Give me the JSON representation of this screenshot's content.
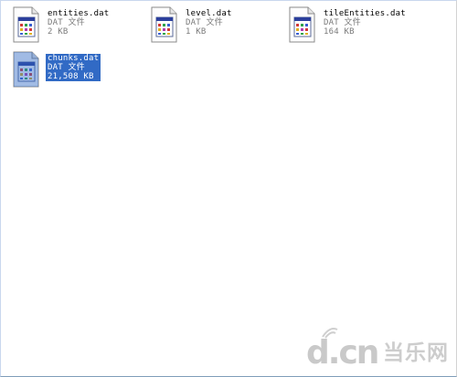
{
  "files": [
    {
      "name": "entities.dat",
      "type": "DAT 文件",
      "size": "2 KB",
      "selected": false
    },
    {
      "name": "level.dat",
      "type": "DAT 文件",
      "size": "1 KB",
      "selected": false
    },
    {
      "name": "tileEntities.dat",
      "type": "DAT 文件",
      "size": "164 KB",
      "selected": false
    },
    {
      "name": "chunks.dat",
      "type": "DAT 文件",
      "size": "21,508 KB",
      "selected": true
    }
  ],
  "watermark": {
    "logo": "d.cn",
    "text": "当乐网"
  },
  "colors": {
    "selection": "#316ac5",
    "secondary_text": "#7a7a7a"
  }
}
